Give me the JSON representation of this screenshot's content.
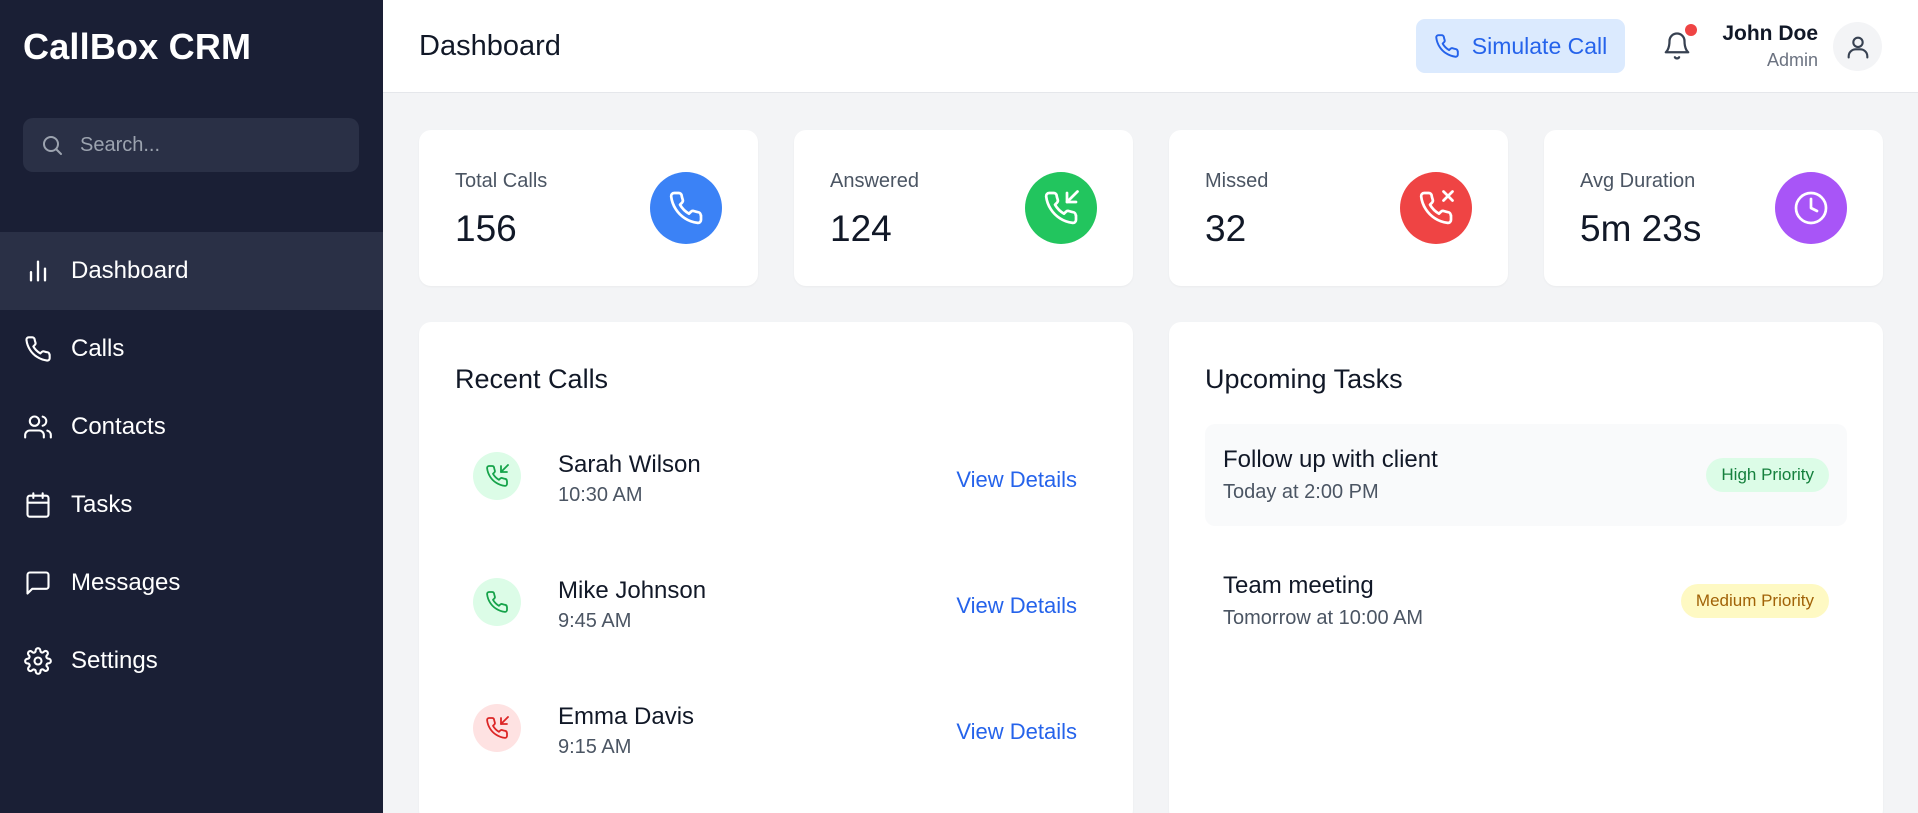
{
  "app": {
    "title": "CallBox CRM"
  },
  "search": {
    "placeholder": "Search..."
  },
  "sidebar": {
    "items": [
      {
        "label": "Dashboard",
        "icon": "bar-chart-icon",
        "active": true
      },
      {
        "label": "Calls",
        "icon": "phone-icon"
      },
      {
        "label": "Contacts",
        "icon": "users-icon"
      },
      {
        "label": "Tasks",
        "icon": "calendar-icon"
      },
      {
        "label": "Messages",
        "icon": "message-icon"
      },
      {
        "label": "Settings",
        "icon": "gear-icon"
      }
    ]
  },
  "header": {
    "title": "Dashboard",
    "simulate_label": "Simulate Call",
    "user": {
      "name": "John Doe",
      "role": "Admin"
    }
  },
  "stats": [
    {
      "label": "Total Calls",
      "value": "156",
      "color": "#3b82f6",
      "icon": "phone-icon"
    },
    {
      "label": "Answered",
      "value": "124",
      "color": "#22c55e",
      "icon": "phone-incoming-icon"
    },
    {
      "label": "Missed",
      "value": "32",
      "color": "#ef4444",
      "icon": "phone-missed-icon"
    },
    {
      "label": "Avg Duration",
      "value": "5m 23s",
      "color": "#a855f7",
      "icon": "clock-icon"
    }
  ],
  "recent_calls": {
    "title": "Recent Calls",
    "link_label": "View Details",
    "items": [
      {
        "name": "Sarah Wilson",
        "time": "10:30 AM",
        "type": "incoming"
      },
      {
        "name": "Mike Johnson",
        "time": "9:45 AM",
        "type": "outgoing"
      },
      {
        "name": "Emma Davis",
        "time": "9:15 AM",
        "type": "missed"
      }
    ]
  },
  "tasks": {
    "title": "Upcoming Tasks",
    "items": [
      {
        "title": "Follow up with client",
        "when": "Today at 2:00 PM",
        "priority": "High Priority"
      },
      {
        "title": "Team meeting",
        "when": "Tomorrow at 10:00 AM",
        "priority": "Medium Priority"
      }
    ]
  },
  "colors": {
    "sidebar_bg": "#1a1f35",
    "accent": "#2563eb",
    "high_badge_bg": "#dcfce7",
    "high_badge_text": "#15803d",
    "medium_badge_bg": "#fef9c3",
    "medium_badge_text": "#a16207"
  }
}
